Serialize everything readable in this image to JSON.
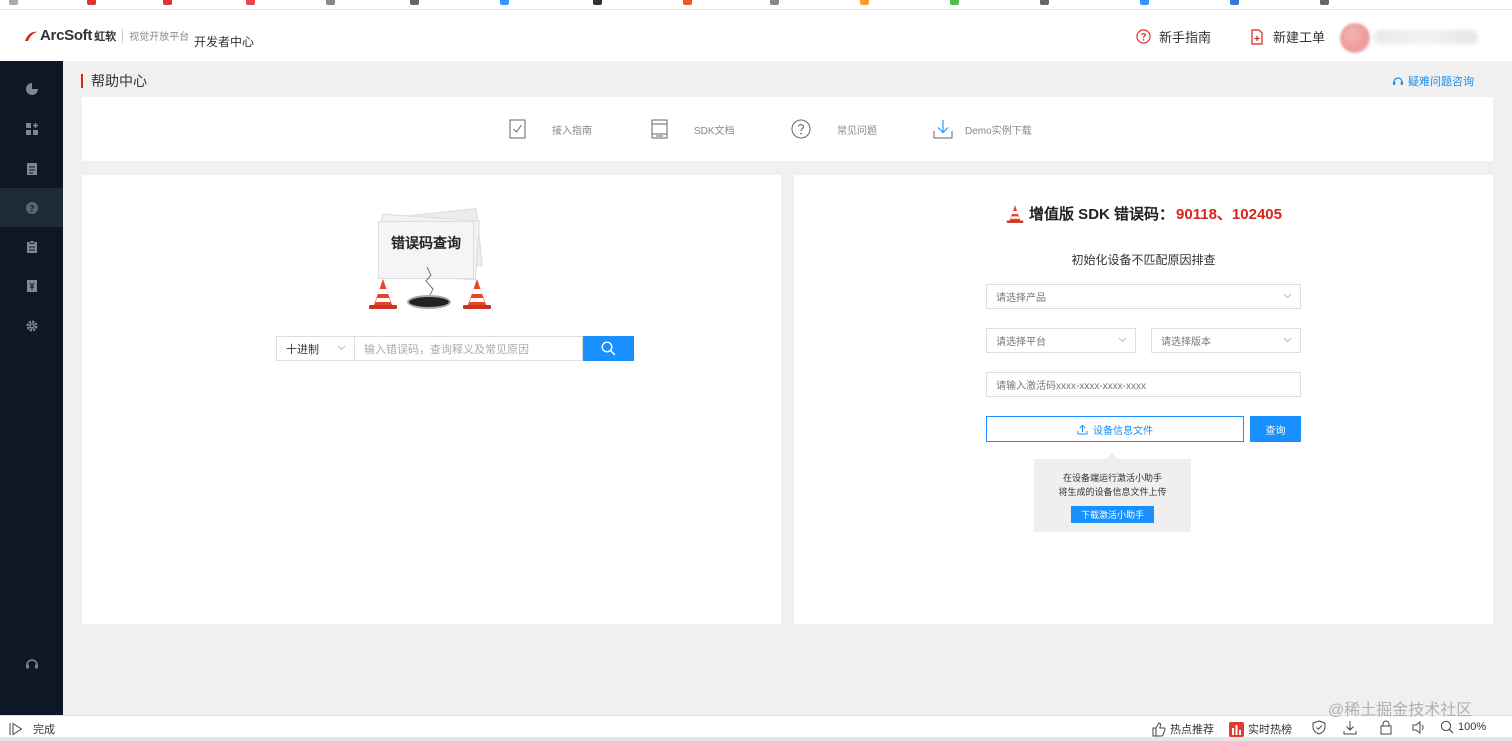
{
  "header": {
    "logo_text": "ArcSoft",
    "logo_cn": "虹软",
    "slogan": "视觉开放平台",
    "dev_center": "开发者中心",
    "guide_link": "新手指南",
    "ticket_link": "新建工单"
  },
  "sidebar": {
    "items": [
      {
        "icon": "dashboard-icon"
      },
      {
        "icon": "apps-icon"
      },
      {
        "icon": "document-icon"
      },
      {
        "icon": "help-icon",
        "active": true
      },
      {
        "icon": "clipboard-icon"
      },
      {
        "icon": "invoice-icon"
      },
      {
        "icon": "settings-icon"
      }
    ],
    "bottom_icon": "headset-icon"
  },
  "main": {
    "breadcrumb": "帮助中心",
    "consult_link": "疑难问题咨询",
    "nav": [
      {
        "label": "接入指南",
        "icon": "checklist-icon"
      },
      {
        "label": "SDK文档",
        "icon": "doc-icon"
      },
      {
        "label": "常见问题",
        "icon": "question-icon"
      },
      {
        "label": "Demo实例下载",
        "icon": "download-icon"
      }
    ]
  },
  "left_panel": {
    "illustration_title": "错误码查询",
    "base_select": "十进制",
    "search_placeholder": "输入错误码，查询释义及常见原因"
  },
  "right_panel": {
    "title_prefix": "增值版 SDK 错误码：",
    "error_codes": "90118、102405",
    "subtitle": "初始化设备不匹配原因排查",
    "product_placeholder": "请选择产品",
    "platform_placeholder": "请选择平台",
    "version_placeholder": "请选择版本",
    "activation_placeholder": "请输入激活码xxxx-xxxx-xxxx-xxxx",
    "upload_label": "设备信息文件",
    "query_label": "查询",
    "tip_line1": "在设备端运行激活小助手",
    "tip_line2": "将生成的设备信息文件上传",
    "tip_button": "下载激活小助手"
  },
  "statusbar": {
    "status": "完成",
    "hot_recommend": "热点推荐",
    "realtime_hot": "实时热榜",
    "zoom": "100%",
    "watermark": "@稀土掘金技术社区"
  },
  "colors": {
    "accent": "#1890ff",
    "brand_red": "#d7251d",
    "sidebar_bg": "#0e1725",
    "page_bg": "#f0f0f0"
  }
}
